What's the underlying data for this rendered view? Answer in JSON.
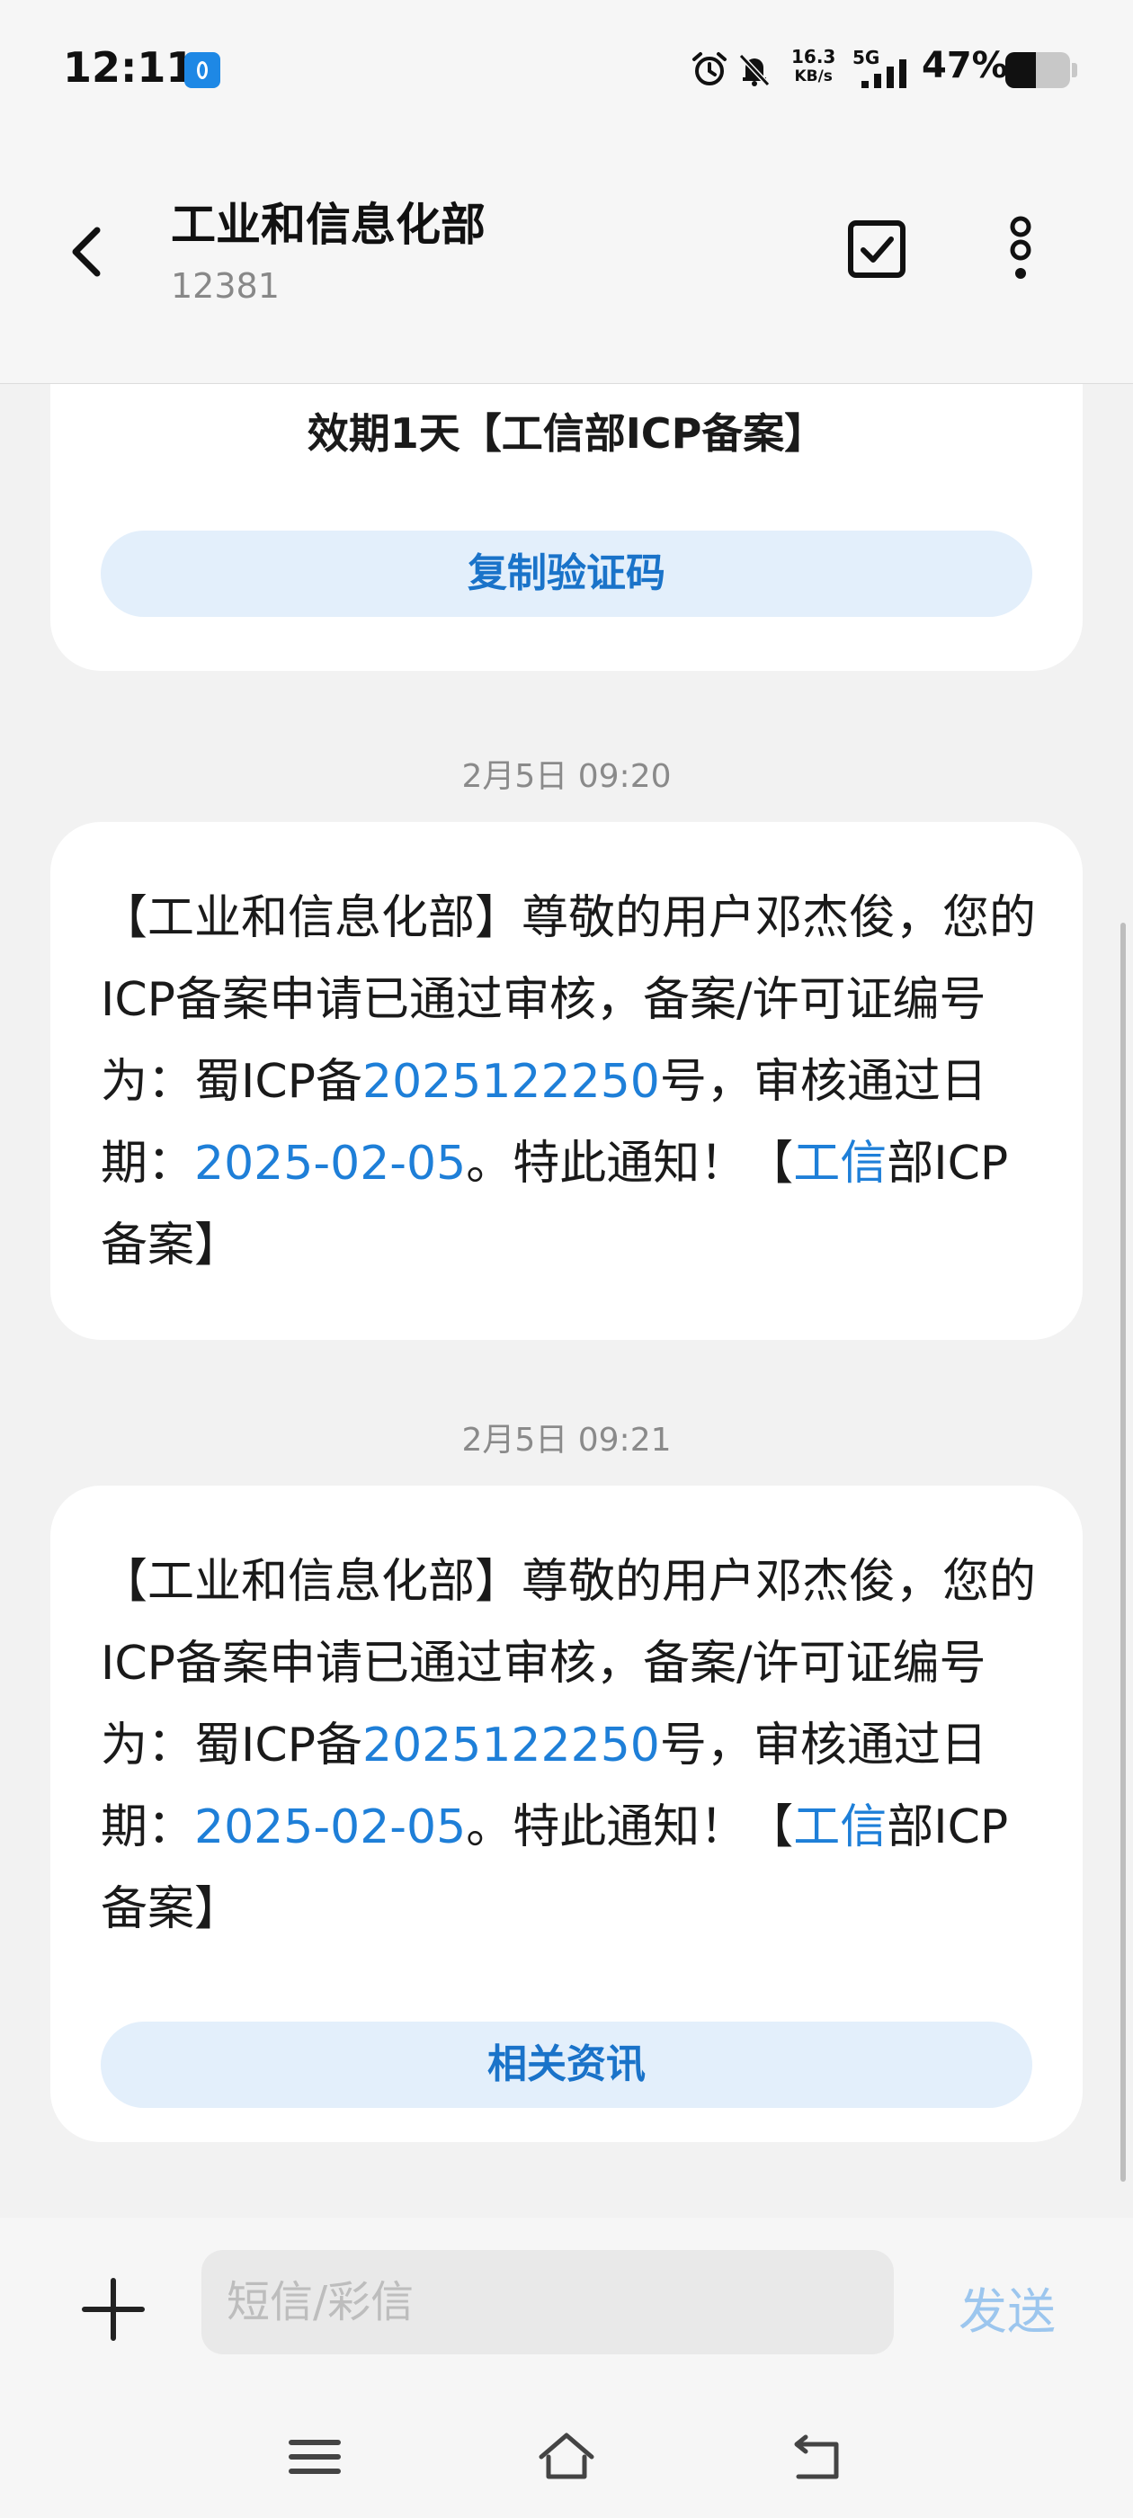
{
  "status_bar": {
    "time": "12:11",
    "net_speed_value": "16.3",
    "net_speed_unit": "KB/s",
    "network": "5G",
    "battery_pct_text": "47%",
    "battery_level": 0.47,
    "icons": [
      "hotspot-icon",
      "alarm-icon",
      "bell-mute-icon",
      "signal-icon",
      "battery-icon"
    ]
  },
  "header": {
    "contact_name": "工业和信息化部",
    "contact_number": "12381",
    "icons": [
      "back-arrow-icon",
      "select-check-icon",
      "more-vert-icon"
    ]
  },
  "messages": [
    {
      "partial_text": "效期1天【工信部ICP备案】",
      "action_label": "复制验证码"
    },
    {
      "timestamp": "2月5日 09:20",
      "text_1": "【工业和信息化部】尊敬的用户邓杰俊，您的ICP备案申请已通过审核，备案/许可证编号为：蜀ICP备",
      "link_number": "2025122250",
      "text_2": "号，审核通过日期：",
      "link_date": "2025-02-05",
      "text_3": "。特此通知！【",
      "link_sender": "工信",
      "text_4": "部ICP备案】"
    },
    {
      "timestamp": "2月5日 09:21",
      "text_1": "【工业和信息化部】尊敬的用户邓杰俊，您的ICP备案申请已通过审核，备案/许可证编号为：蜀ICP备",
      "link_number": "2025122250",
      "text_2": "号，审核通过日期：",
      "link_date": "2025-02-05",
      "text_3": "。特此通知！【",
      "link_sender": "工信",
      "text_4": "部ICP备案】",
      "action_label": "相关资讯"
    }
  ],
  "input_bar": {
    "placeholder": "短信/彩信",
    "send_label": "发送"
  },
  "nav_bar": {
    "icons": [
      "menu-icon",
      "home-icon",
      "back-icon"
    ]
  },
  "colors": {
    "link": "#1e7fd8",
    "pill_bg": "#e3effb",
    "send_disabled": "#9cc6ee"
  }
}
